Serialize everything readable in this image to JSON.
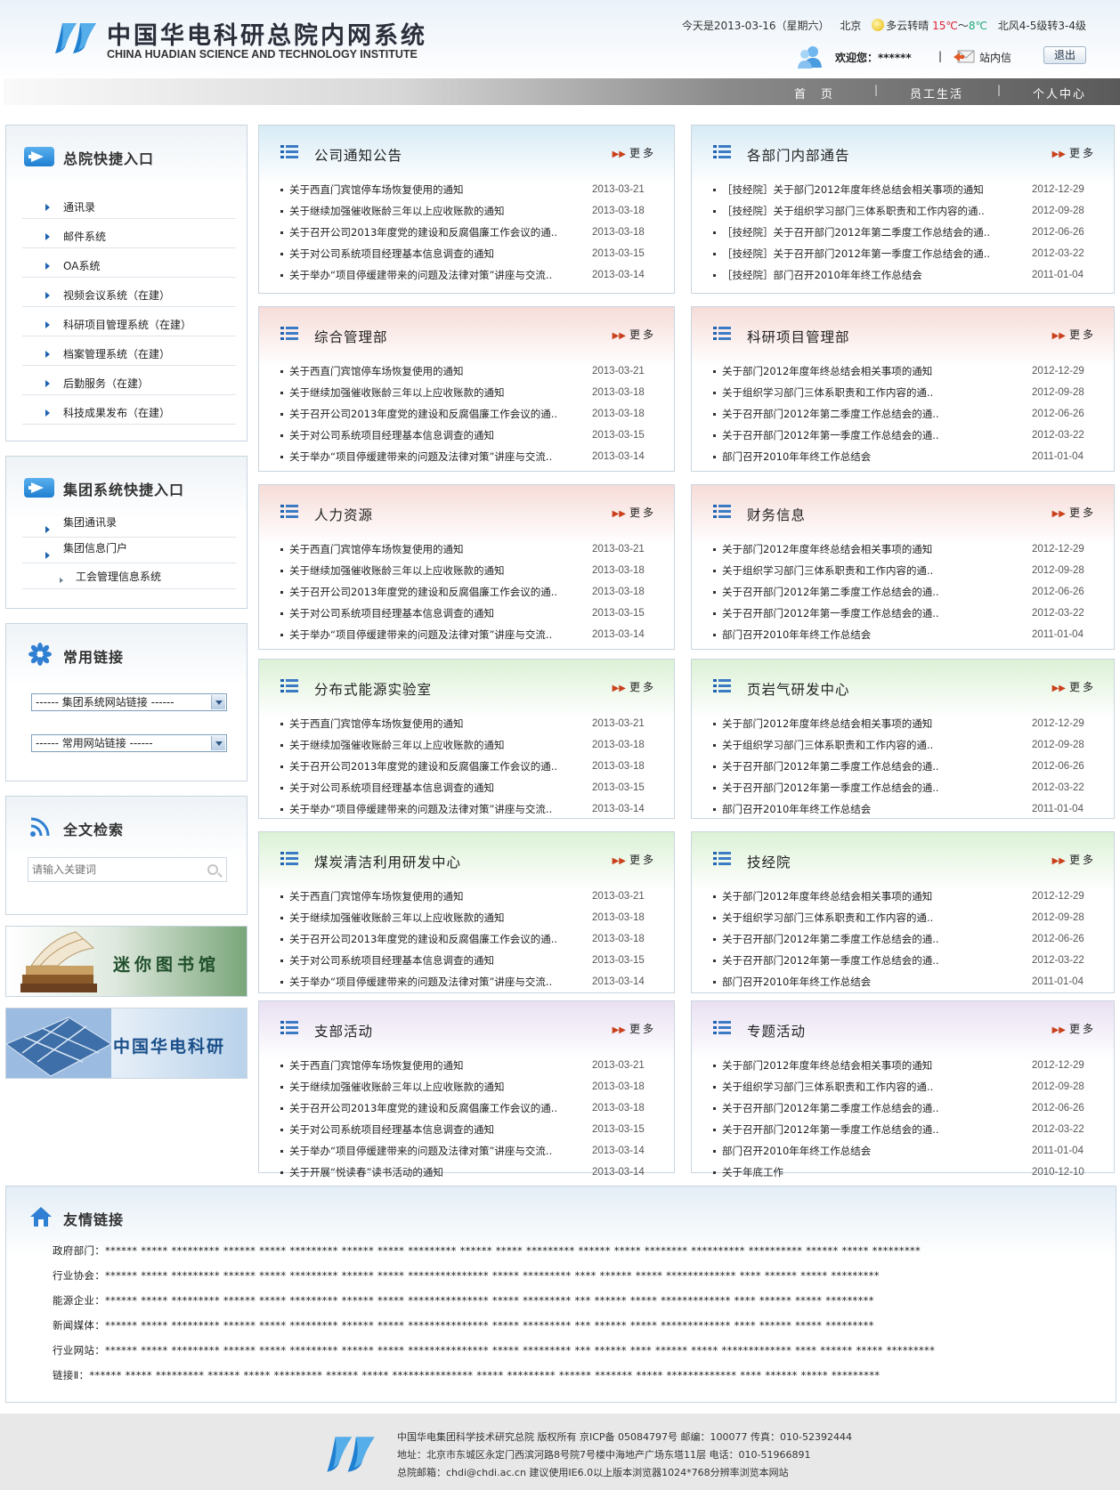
{
  "header": {
    "title_cn": "中国华电科研总院内网系统",
    "title_en": "CHINA HUADIAN SCIENCE AND TECHNOLOGY INSTITUTE",
    "date_text": "今天是2013-03-16（星期六）",
    "city": "北京",
    "weather": "多云转晴",
    "temp_hi": "15℃",
    "temp_tilde": "～",
    "temp_lo": "8℃",
    "wind": "北风4-5级转3-4级",
    "welcome": "欢迎您：******",
    "divider": "|",
    "mail_label": "站内信",
    "logout_label": "退出"
  },
  "nav": {
    "items": [
      {
        "label": "首　页"
      },
      {
        "label": "员工生活"
      },
      {
        "label": "个人中心"
      }
    ],
    "separator": "|"
  },
  "sidebar": {
    "quick_entry": {
      "title": "总院快捷入口",
      "items": [
        "通讯录",
        "邮件系统",
        "OA系统",
        "视频会议系统（在建）",
        "科研项目管理系统（在建）",
        "档案管理系统（在建）",
        "后勤服务（在建）",
        "科技成果发布（在建）"
      ]
    },
    "group_entry": {
      "title": "集团系统快捷入口",
      "items": [
        "集团通讯录",
        "集团信息门户"
      ],
      "sub_items": [
        "工会管理信息系统"
      ]
    },
    "links": {
      "title": "常用链接",
      "select1": "------  集团系统网站链接  ------",
      "select2": "------  常用网站链接  ------"
    },
    "search": {
      "title": "全文检索",
      "placeholder": "请输入关键词"
    },
    "banner_library": "迷你图书馆",
    "banner_huadian": "中国华电科研"
  },
  "more_label": "更多",
  "panels": [
    {
      "title": "公司通知公告",
      "theme": "#d7ebf5",
      "rows": [
        [
          "关于西直门宾馆停车场恢复使用的通知",
          "2013-03-21"
        ],
        [
          "关于继续加强催收账龄三年以上应收账款的通知",
          "2013-03-18"
        ],
        [
          "关于召开公司2013年度党的建设和反腐倡廉工作会议的通..",
          "2013-03-18"
        ],
        [
          "关于对公司系统项目经理基本信息调查的通知",
          "2013-03-15"
        ],
        [
          "关于举办“项目停缓建带来的问题及法律对策”讲座与交流..",
          "2013-03-14"
        ]
      ]
    },
    {
      "title": "各部门内部通告",
      "theme": "#d7ebf5",
      "rows": [
        [
          "［技经院］关于部门2012年度年终总结会相关事项的通知",
          "2012-12-29"
        ],
        [
          "［技经院］关于组织学习部门三体系职责和工作内容的通..",
          "2012-09-28"
        ],
        [
          "［技经院］关于召开部门2012年第二季度工作总结会的通..",
          "2012-06-26"
        ],
        [
          "［技经院］关于召开部门2012年第一季度工作总结会的通..",
          "2012-03-22"
        ],
        [
          "［技经院］部门召开2010年年终工作总结会",
          "2011-01-04"
        ]
      ]
    },
    {
      "title": "综合管理部",
      "theme": "#f6dcd8",
      "rows": [
        [
          "关于西直门宾馆停车场恢复使用的通知",
          "2013-03-21"
        ],
        [
          "关于继续加强催收账龄三年以上应收账款的通知",
          "2013-03-18"
        ],
        [
          "关于召开公司2013年度党的建设和反腐倡廉工作会议的通..",
          "2013-03-18"
        ],
        [
          "关于对公司系统项目经理基本信息调查的通知",
          "2013-03-15"
        ],
        [
          "关于举办“项目停缓建带来的问题及法律对策”讲座与交流..",
          "2013-03-14"
        ]
      ]
    },
    {
      "title": "科研项目管理部",
      "theme": "#f6dcd8",
      "rows": [
        [
          "关于部门2012年度年终总结会相关事项的通知",
          "2012-12-29"
        ],
        [
          "关于组织学习部门三体系职责和工作内容的通..",
          "2012-09-28"
        ],
        [
          "关于召开部门2012年第二季度工作总结会的通..",
          "2012-06-26"
        ],
        [
          "关于召开部门2012年第一季度工作总结会的通..",
          "2012-03-22"
        ],
        [
          "部门召开2010年年终工作总结会",
          "2011-01-04"
        ]
      ]
    },
    {
      "title": "人力资源",
      "theme": "#f6dcd8",
      "rows": [
        [
          "关于西直门宾馆停车场恢复使用的通知",
          "2013-03-21"
        ],
        [
          "关于继续加强催收账龄三年以上应收账款的通知",
          "2013-03-18"
        ],
        [
          "关于召开公司2013年度党的建设和反腐倡廉工作会议的通..",
          "2013-03-18"
        ],
        [
          "关于对公司系统项目经理基本信息调查的通知",
          "2013-03-15"
        ],
        [
          "关于举办“项目停缓建带来的问题及法律对策”讲座与交流..",
          "2013-03-14"
        ]
      ]
    },
    {
      "title": "财务信息",
      "theme": "#f6dcd8",
      "rows": [
        [
          "关于部门2012年度年终总结会相关事项的通知",
          "2012-12-29"
        ],
        [
          "关于组织学习部门三体系职责和工作内容的通..",
          "2012-09-28"
        ],
        [
          "关于召开部门2012年第二季度工作总结会的通..",
          "2012-06-26"
        ],
        [
          "关于召开部门2012年第一季度工作总结会的通..",
          "2012-03-22"
        ],
        [
          "部门召开2010年年终工作总结会",
          "2011-01-04"
        ]
      ]
    },
    {
      "title": "分布式能源实验室",
      "theme": "#dcf1d6",
      "rows": [
        [
          "关于西直门宾馆停车场恢复使用的通知",
          "2013-03-21"
        ],
        [
          "关于继续加强催收账龄三年以上应收账款的通知",
          "2013-03-18"
        ],
        [
          "关于召开公司2013年度党的建设和反腐倡廉工作会议的通..",
          "2013-03-18"
        ],
        [
          "关于对公司系统项目经理基本信息调查的通知",
          "2013-03-15"
        ],
        [
          "关于举办“项目停缓建带来的问题及法律对策”讲座与交流..",
          "2013-03-14"
        ]
      ]
    },
    {
      "title": "页岩气研发中心",
      "theme": "#dcf1d6",
      "rows": [
        [
          "关于部门2012年度年终总结会相关事项的通知",
          "2012-12-29"
        ],
        [
          "关于组织学习部门三体系职责和工作内容的通..",
          "2012-09-28"
        ],
        [
          "关于召开部门2012年第二季度工作总结会的通..",
          "2012-06-26"
        ],
        [
          "关于召开部门2012年第一季度工作总结会的通..",
          "2012-03-22"
        ],
        [
          "部门召开2010年年终工作总结会",
          "2011-01-04"
        ]
      ]
    },
    {
      "title": "煤炭清洁利用研发中心",
      "theme": "#dcf1d6",
      "rows": [
        [
          "关于西直门宾馆停车场恢复使用的通知",
          "2013-03-21"
        ],
        [
          "关于继续加强催收账龄三年以上应收账款的通知",
          "2013-03-18"
        ],
        [
          "关于召开公司2013年度党的建设和反腐倡廉工作会议的通..",
          "2013-03-18"
        ],
        [
          "关于对公司系统项目经理基本信息调查的通知",
          "2013-03-15"
        ],
        [
          "关于举办“项目停缓建带来的问题及法律对策”讲座与交流..",
          "2013-03-14"
        ]
      ]
    },
    {
      "title": "技经院",
      "theme": "#dcf1d6",
      "rows": [
        [
          "关于部门2012年度年终总结会相关事项的通知",
          "2012-12-29"
        ],
        [
          "关于组织学习部门三体系职责和工作内容的通..",
          "2012-09-28"
        ],
        [
          "关于召开部门2012年第二季度工作总结会的通..",
          "2012-06-26"
        ],
        [
          "关于召开部门2012年第一季度工作总结会的通..",
          "2012-03-22"
        ],
        [
          "部门召开2010年年终工作总结会",
          "2011-01-04"
        ]
      ]
    },
    {
      "title": "支部活动",
      "theme": "#e9e0f2",
      "rows": [
        [
          "关于西直门宾馆停车场恢复使用的通知",
          "2013-03-21"
        ],
        [
          "关于继续加强催收账龄三年以上应收账款的通知",
          "2013-03-18"
        ],
        [
          "关于召开公司2013年度党的建设和反腐倡廉工作会议的通..",
          "2013-03-18"
        ],
        [
          "关于对公司系统项目经理基本信息调查的通知",
          "2013-03-15"
        ],
        [
          "关于举办“项目停缓建带来的问题及法律对策”讲座与交流..",
          "2013-03-14"
        ],
        [
          "关于开展“悦读春”读书活动的通知",
          "2013-03-14"
        ]
      ]
    },
    {
      "title": "专题活动",
      "theme": "#e9e0f2",
      "rows": [
        [
          "关于部门2012年度年终总结会相关事项的通知",
          "2012-12-29"
        ],
        [
          "关于组织学习部门三体系职责和工作内容的通..",
          "2012-09-28"
        ],
        [
          "关于召开部门2012年第二季度工作总结会的通..",
          "2012-06-26"
        ],
        [
          "关于召开部门2012年第一季度工作总结会的通..",
          "2012-03-22"
        ],
        [
          "部门召开2010年年终工作总结会",
          "2011-01-04"
        ],
        [
          "关于年底工作",
          "2010-12-10"
        ]
      ]
    }
  ],
  "friends": {
    "title": "友情链接",
    "rows": [
      "政府部门：****** *****   ********* ****** *****   ********* ****** *****   ********* ****** *****   ********* ****** *****   ********   ********** ********** ****** *****   *********",
      "行业协会：****** *****   ********* ****** *****   ********* ****** *****   *************** *****   ********* **** ****** *****   ************* **** ****** *****   *********",
      "能源企业：****** *****   ********* ****** *****   ********* ****** *****   *************** *****   ********* *** ****** *****   ************* **** ****** *****   *********",
      "新闻媒体：****** *****   ********* ****** *****   ********* ****** *****   *************** *****   ********* *** ****** *****   ************* **** ****** *****   *********",
      "行业网站：****** *****   ********* ****** *****   ********* ****** *****   *************** *****   ********* *** ****** **** ****** *****   ************* **** ****** *****   *********",
      "链接Ⅱ：****** *****   ********* ****** *****   ********* ****** *****   *************** *****   ********* ****** ******* *****   ************* **** ****** *****   *********"
    ]
  },
  "footer": {
    "line1": "中国华电集团科学技术研究总院  版权所有  京ICP备  05084797号  邮编：100077 传真：010-52392444",
    "line2": "地址：北京市东城区永定门西滨河路8号院7号楼中海地产广场东塔11层  电话：010-51966891",
    "line3": "总院邮箱：chdi@chdi.ac.cn 建议使用IE6.0以上版本浏览器1024*768分辨率浏览本网站"
  }
}
